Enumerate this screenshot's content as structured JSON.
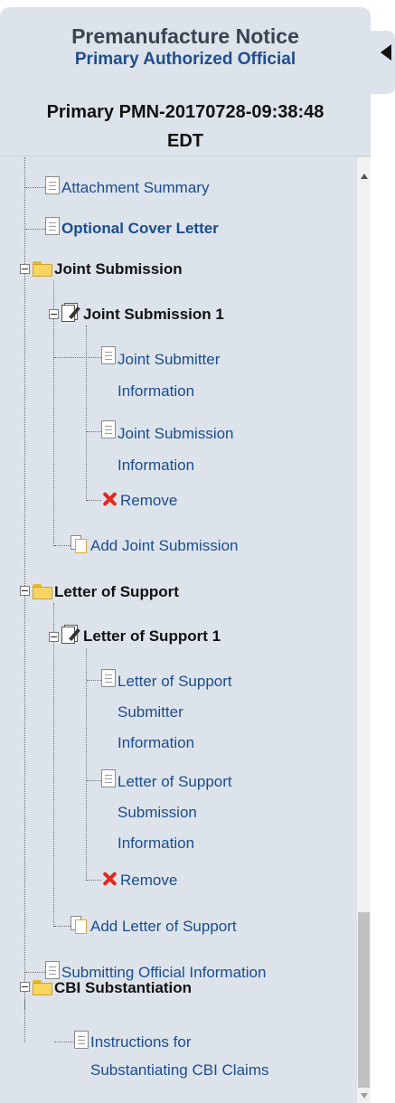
{
  "header": {
    "title": "Premanufacture Notice",
    "subtitle": "Primary Authorized Official",
    "submission_id_line1": "Primary PMN-20170728-09:38:48",
    "submission_id_line2": "EDT"
  },
  "tree": {
    "attachment_summary": "Attachment Summary",
    "optional_cover_letter": "Optional Cover Letter",
    "joint_submission": "Joint Submission",
    "joint_submission_1": "Joint Submission 1",
    "joint_submitter_info": [
      "Joint Submitter",
      "Information"
    ],
    "joint_submission_info": [
      "Joint Submission",
      "Information"
    ],
    "remove_1": "Remove",
    "add_joint_submission": "Add Joint Submission",
    "letter_of_support": "Letter of Support",
    "letter_of_support_1": "Letter of Support 1",
    "los_submitter_info": [
      "Letter of Support",
      "Submitter",
      "Information"
    ],
    "los_submission_info": [
      "Letter of Support",
      "Submission",
      "Information"
    ],
    "remove_2": "Remove",
    "add_letter_of_support": "Add Letter of Support",
    "submitting_official_info": "Submitting Official Information",
    "cbi_substantiation": "CBI Substantiation",
    "cbi_instructions": [
      "Instructions for",
      "Substantiating CBI Claims"
    ]
  },
  "icons": {
    "document": "document-icon",
    "folder": "folder-icon",
    "edit": "edit-form-icon",
    "remove": "red-x-icon",
    "add": "add-document-icon",
    "collapse": "collapse-arrow-icon"
  },
  "colors": {
    "panel_bg": "#dde3ea",
    "link_blue": "#1a4d8f",
    "remove_red": "#e2291f",
    "folder_yellow": "#f7d560"
  }
}
